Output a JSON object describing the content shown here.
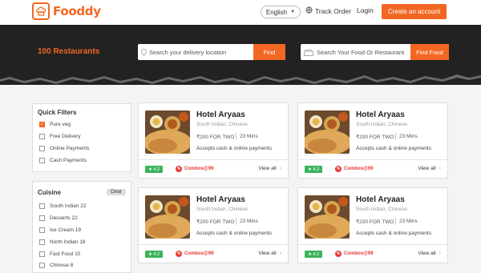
{
  "header": {
    "brand": "Fooddy",
    "language": "English",
    "track_order": "Track Order",
    "login": "Login",
    "create_account": "Create an account"
  },
  "hero": {
    "restaurant_count": "100 Restaurants",
    "location_placeholder": "Search your delivery location",
    "find_label": "Find",
    "food_placeholder": "Search Your Food Or Restaurant",
    "find_food_label": "Find Food"
  },
  "filters": {
    "quick_title": "Quick Filters",
    "quick_items": [
      {
        "label": "Pure veg",
        "checked": true
      },
      {
        "label": "Free Delivery",
        "checked": false
      },
      {
        "label": "Online Payments",
        "checked": false
      },
      {
        "label": "Cash Payments",
        "checked": false
      }
    ],
    "cuisine_title": "Cuisine",
    "clear_label": "Clear",
    "cuisine_items": [
      {
        "label": "South Indian 22"
      },
      {
        "label": "Desserts 22"
      },
      {
        "label": "Ice Cream 19"
      },
      {
        "label": "North Indian 18"
      },
      {
        "label": "Fast Food 10"
      },
      {
        "label": "Chinese 8"
      }
    ]
  },
  "restaurants": [
    {
      "name": "Hotel Aryaas",
      "cuisine": "South Indian, Chinese",
      "price": "₹200 FOR TWO",
      "time": "23 Mins",
      "payment": "Accepts cash & online payments",
      "rating": "★ 4.2",
      "offer": "Combos@99",
      "view_all": "View all"
    },
    {
      "name": "Hotel Aryaas",
      "cuisine": "South Indian, Chinese",
      "price": "₹200 FOR TWO",
      "time": "23 Mins",
      "payment": "Accepts cash & online payments",
      "rating": "★ 4.2",
      "offer": "Combos@99",
      "view_all": "View all"
    },
    {
      "name": "Hotel Aryaas",
      "cuisine": "South Indian, Chinese",
      "price": "₹200 FOR TWO",
      "time": "23 Mins",
      "payment": "Accepts cash & online payments",
      "rating": "★ 4.2",
      "offer": "Combos@99",
      "view_all": "View all"
    },
    {
      "name": "Hotel Aryaas",
      "cuisine": "South Indian, Chinese",
      "price": "₹200 FOR TWO",
      "time": "23 Mins",
      "payment": "Accepts cash & online payments",
      "rating": "★ 4.2",
      "offer": "Combos@99",
      "view_all": "View all"
    }
  ],
  "colors": {
    "accent": "#f26722",
    "hero_bg": "#222222",
    "rating_green": "#3cb35a",
    "offer_red": "#e53935"
  },
  "icons": [
    "chef-hat-icon",
    "globe-icon",
    "location-pin-icon",
    "search-icon",
    "chevron-down-icon",
    "chevron-right-icon",
    "offer-icon",
    "star-icon"
  ]
}
